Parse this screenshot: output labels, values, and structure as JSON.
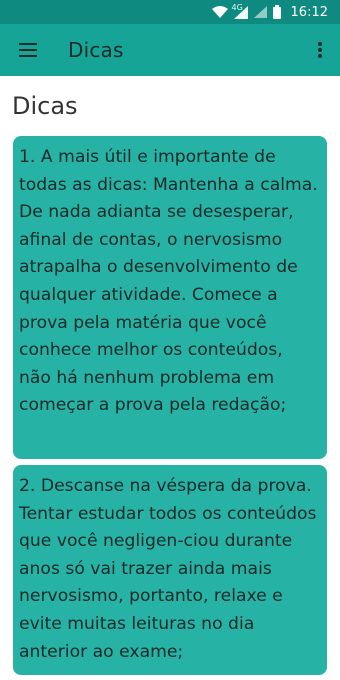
{
  "status_bar": {
    "network_label": "4G",
    "time": "16:12"
  },
  "toolbar": {
    "title": "Dicas"
  },
  "page": {
    "heading": "Dicas"
  },
  "tips": [
    {
      "text": "1. A mais útil e importante de todas as dicas: Mantenha a calma. De nada adianta se desesperar, afinal de contas, o nervosismo atrapalha o desenvolvimento de qualquer atividade. Comece a prova pela matéria que você conhece melhor os conteúdos, não há nenhum problema em começar a prova pela redação;"
    },
    {
      "text": "2. Descanse na véspera da prova. Tentar estudar todos os conteúdos que você negligen-ciou durante anos só vai trazer ainda mais nervosismo, portanto, relaxe e evite muitas leituras no dia anterior ao exame;"
    }
  ],
  "colors": {
    "status_bar": "#0f8a80",
    "toolbar": "#16a497",
    "card": "#26b3a6"
  }
}
